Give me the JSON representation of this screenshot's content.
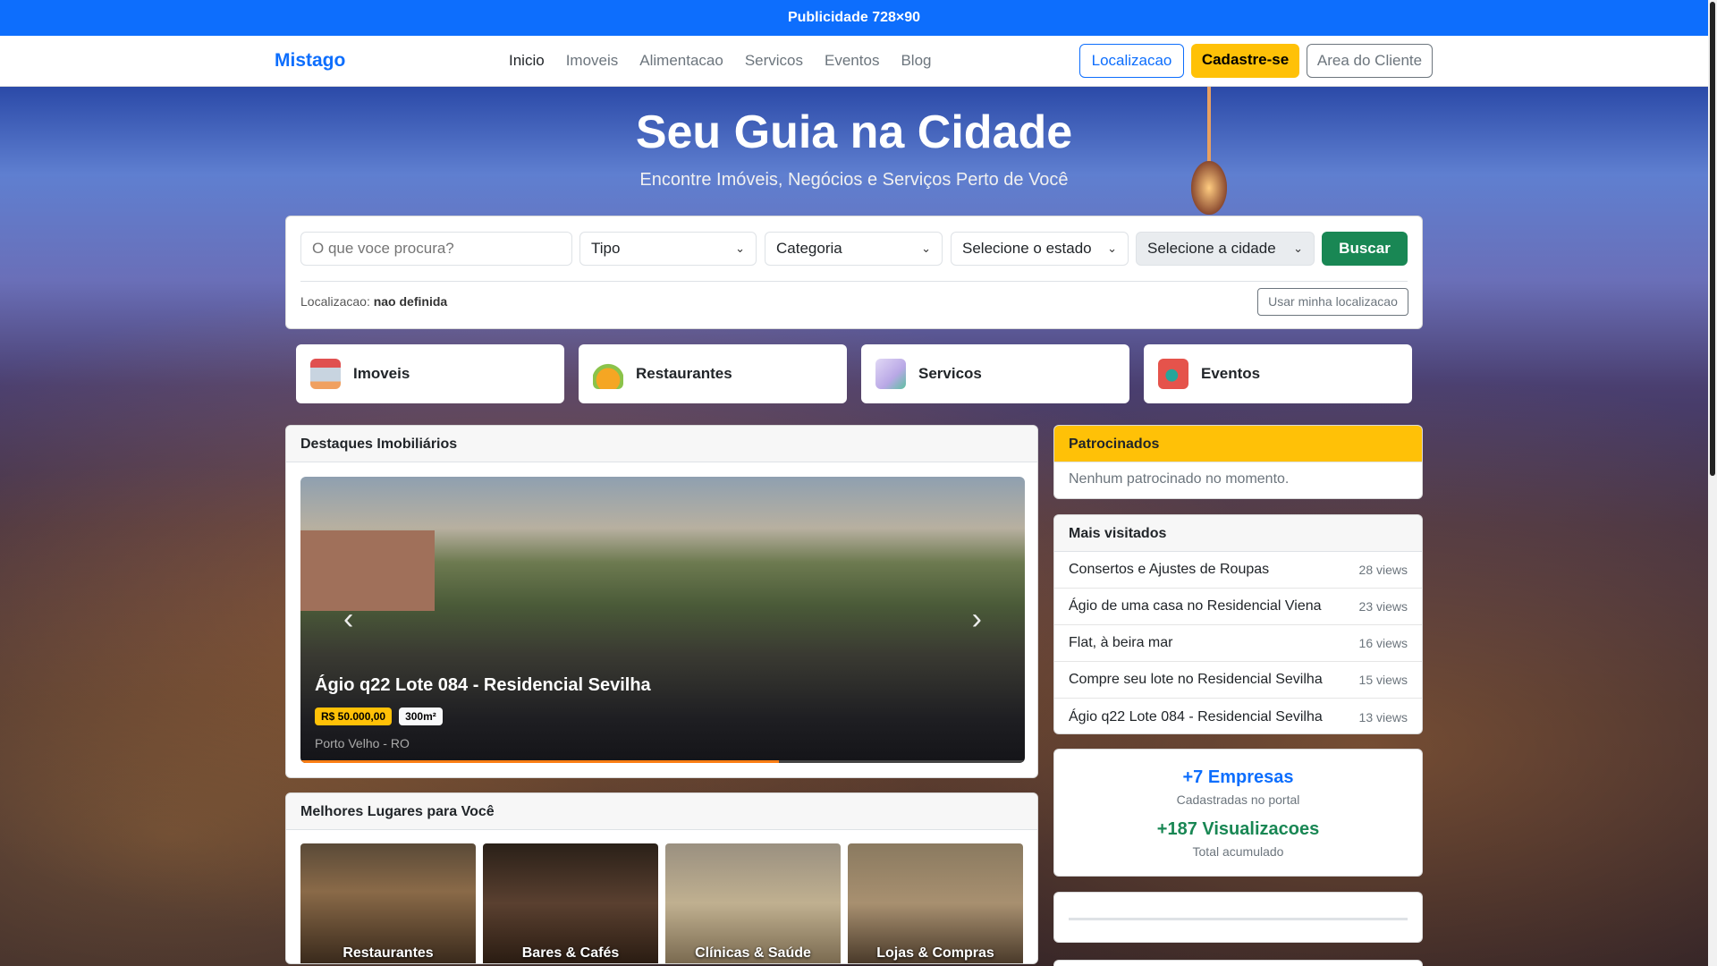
{
  "banner": {
    "text": "Publicidade 728×90"
  },
  "nav": {
    "logo": "Mistago",
    "links": [
      "Inicio",
      "Imoveis",
      "Alimentacao",
      "Servicos",
      "Eventos",
      "Blog"
    ],
    "buttons": {
      "location": "Localizacao",
      "signup": "Cadastre-se",
      "client_area": "Area do Cliente"
    }
  },
  "hero": {
    "title": "Seu Guia na Cidade",
    "subtitle": "Encontre Imóveis, Negócios e Serviços Perto de Você"
  },
  "search": {
    "placeholder": "O que voce procura?",
    "type": "Tipo",
    "category": "Categoria",
    "state": "Selecione o estado",
    "city": "Selecione a cidade",
    "submit": "Buscar",
    "location_label": "Localizacao:",
    "location_value": "nao definida",
    "use_location": "Usar minha localizacao"
  },
  "categories": [
    {
      "label": "Imoveis",
      "icon": "house-icon"
    },
    {
      "label": "Restaurantes",
      "icon": "food-bowl-icon"
    },
    {
      "label": "Servicos",
      "icon": "checklist-icon"
    },
    {
      "label": "Eventos",
      "icon": "calendar-info-icon"
    }
  ],
  "featured": {
    "title": "Destaques Imobiliários",
    "slide": {
      "title": "Ágio q22 Lote 084 - Residencial Sevilha",
      "price": "R$ 50.000,00",
      "area": "300m²",
      "location": "Porto Velho - RO",
      "progress": 0.66
    }
  },
  "best_places": {
    "title": "Melhores Lugares para Você",
    "items": [
      "Restaurantes",
      "Bares & Cafés",
      "Clínicas & Saúde",
      "Lojas & Compras"
    ]
  },
  "sponsored": {
    "title": "Patrocinados",
    "empty": "Nenhum patrocinado no momento."
  },
  "most_visited": {
    "title": "Mais visitados",
    "items": [
      {
        "name": "Consertos e Ajustes de Roupas",
        "views": "28 views"
      },
      {
        "name": "Ágio de uma casa no Residencial Viena",
        "views": "23 views"
      },
      {
        "name": "Flat, à beira mar",
        "views": "16 views"
      },
      {
        "name": "Compre seu lote no Residencial Sevilha",
        "views": "15 views"
      },
      {
        "name": "Ágio q22 Lote 084 - Residencial Sevilha",
        "views": "13 views"
      }
    ]
  },
  "stats": {
    "companies": "+7 Empresas",
    "companies_label": "Cadastradas no portal",
    "views": "+187 Visualizacoes",
    "views_label": "Total acumulado"
  },
  "colors": {
    "primary": "#0d6efd",
    "warning": "#ffc107",
    "success": "#198754",
    "progress": "#fd7e14"
  }
}
